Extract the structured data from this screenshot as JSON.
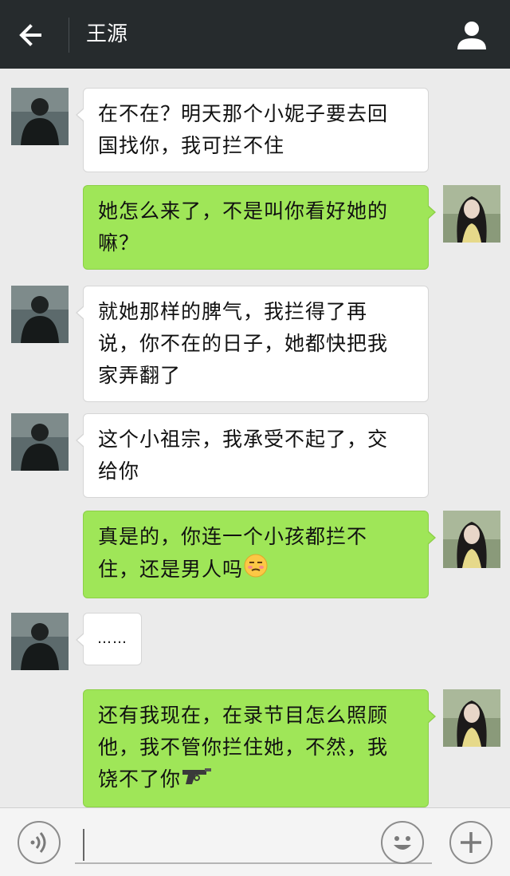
{
  "header": {
    "back_icon": "arrow-left-icon",
    "title": "王源",
    "profile_icon": "user-icon"
  },
  "colors": {
    "topbar": "#262b2d",
    "background": "#ebebeb",
    "sent_bubble": "#9fe658",
    "received_bubble": "#ffffff"
  },
  "messages": [
    {
      "side": "left",
      "lines": [
        "在不在？明天那个小妮子要去回",
        "国找你，我可拦不住"
      ]
    },
    {
      "side": "right",
      "lines": [
        "她怎么来了，不是叫你看好她的",
        "嘛？"
      ]
    },
    {
      "side": "left",
      "lines": [
        "就她那样的脾气，我拦得了再",
        "说，你不在的日子，她都快把我",
        "家弄翻了"
      ]
    },
    {
      "side": "left",
      "lines": [
        "这个小祖宗，我承受不起了，交",
        "给你"
      ]
    },
    {
      "side": "right",
      "lines": [
        "真是的，你连一个小孩都拦不",
        "住，还是男人吗"
      ],
      "emoji": "unamused-face-emoji"
    },
    {
      "side": "left",
      "lines": [
        "……"
      ]
    },
    {
      "side": "right",
      "lines": [
        "还有我现在，在录节目怎么照顾",
        "他，我不管你拦住她，不然，我",
        "饶不了你"
      ],
      "emoji": "pistol-emoji"
    }
  ],
  "input_bar": {
    "voice_icon": "voice-icon",
    "emoji_icon": "smiley-icon",
    "plus_icon": "plus-icon",
    "input_value": ""
  }
}
